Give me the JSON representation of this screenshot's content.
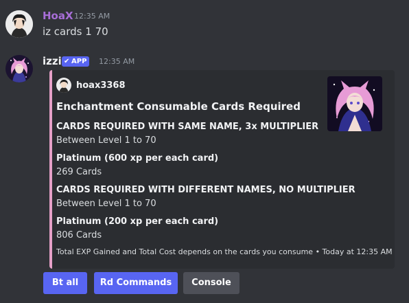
{
  "messages": [
    {
      "username": "HoaX",
      "username_color": "#a86ed8",
      "timestamp": "12:35 AM",
      "text": "iz cards 1 70"
    },
    {
      "username": "izzi",
      "badge": "APP",
      "badge_icon": "check-icon",
      "timestamp": "12:35 AM",
      "embed": {
        "accent_color": "#e6a0c8",
        "author": "hoax3368",
        "title": "Enchantment Consumable Cards Required",
        "fields": [
          {
            "name": "CARDS REQUIRED WITH SAME NAME, 3x MULTIPLIER",
            "value": "Between Level 1 to 70"
          },
          {
            "name": "Platinum (600 xp per each card)",
            "value": "269 Cards"
          },
          {
            "name": "CARDS REQUIRED WITH DIFFERENT NAMES, NO MULTIPLIER",
            "value": "Between Level 1 to 70"
          },
          {
            "name": "Platinum (200 xp per each card)",
            "value": "806 Cards"
          }
        ],
        "footer": "Total EXP Gained and Total Cost depends on the cards you consume • Today at 12:35 AM"
      },
      "buttons": [
        {
          "label": "Bt all",
          "style": "primary"
        },
        {
          "label": "Rd Commands",
          "style": "primary"
        },
        {
          "label": "Console",
          "style": "secondary"
        }
      ]
    }
  ],
  "colors": {
    "background": "#313338",
    "embed_background": "#2b2d31",
    "blurple": "#5865f2",
    "secondary_button": "#4e5058"
  }
}
